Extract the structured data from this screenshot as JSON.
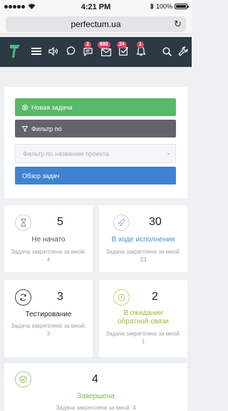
{
  "statusbar": {
    "time": "4:21 PM",
    "battery": "100%"
  },
  "browser": {
    "url": "perfectum.ua",
    "reload_icon": "reload-icon"
  },
  "header": {
    "badges": {
      "messages": "2",
      "mail": "690",
      "tasks": "24",
      "notifications": "1"
    },
    "accent": "#2d3a44"
  },
  "panel": {
    "new_task": "Новая задача",
    "filter": "Фильтр по",
    "project_filter_placeholder": "Фильтр по названию проекта",
    "overview": "Обзор задач"
  },
  "stats": [
    {
      "count": "5",
      "label": "Не начато",
      "sub": "Задача закреплена за мной: 4",
      "color": "#555555",
      "icon": "hourglass-icon"
    },
    {
      "count": "30",
      "label": "В ходе исполнения",
      "sub": "Задача закреплена за мной: 23",
      "color": "#3f97c9",
      "icon": "rocket-icon"
    },
    {
      "count": "3",
      "label": "Тестирование",
      "sub": "Задача закреплена за мной: 3",
      "color": "#222222",
      "icon": "refresh-icon"
    },
    {
      "count": "2",
      "label": "В ожидании обратной связи",
      "sub": "Задача закреплена за мной: 1",
      "color": "#9bbc3a",
      "icon": "clock-icon"
    },
    {
      "count": "4",
      "label": "Завершена",
      "sub": "Задача закреплена за мной: 4",
      "color": "#7fba4a",
      "icon": "check-circle-icon"
    }
  ]
}
